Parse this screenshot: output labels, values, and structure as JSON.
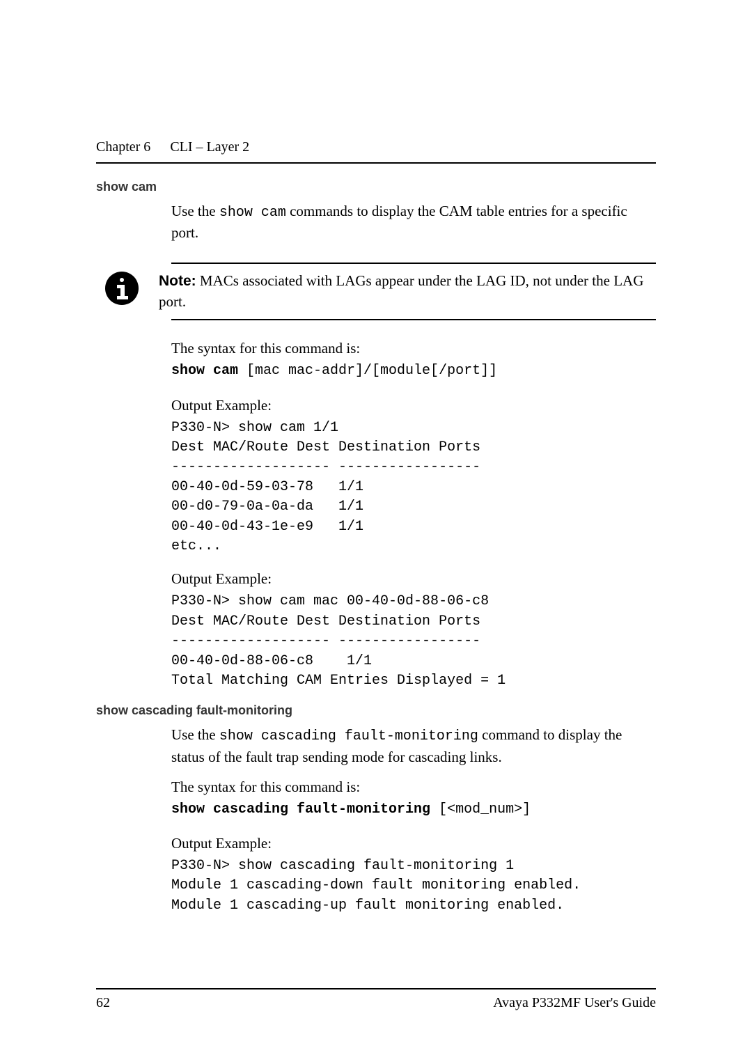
{
  "header": {
    "chapter": "Chapter 6",
    "title": "CLI – Layer 2"
  },
  "section1": {
    "heading": "show cam",
    "intro_pre": "Use the ",
    "intro_cmd": "show cam",
    "intro_post": " commands to display the CAM table entries for a specific port.",
    "note": {
      "label": "Note:",
      "text": "  MACs associated with LAGs appear under the LAG ID, not under the LAG port."
    },
    "syntax_label": "The syntax for this command is:",
    "syntax_cmd": "show cam",
    "syntax_args": " [mac mac-addr]/[module[/port]]",
    "example1_label": "Output Example:",
    "example1_code": "P330-N> show cam 1/1\nDest MAC/Route Dest Destination Ports\n------------------- -----------------\n00-40-0d-59-03-78   1/1\n00-d0-79-0a-0a-da   1/1\n00-40-0d-43-1e-e9   1/1\netc...",
    "example2_label": "Output Example:",
    "example2_code": "P330-N> show cam mac 00-40-0d-88-06-c8\nDest MAC/Route Dest Destination Ports\n------------------- -----------------\n00-40-0d-88-06-c8    1/1\nTotal Matching CAM Entries Displayed = 1"
  },
  "section2": {
    "heading": "show cascading fault-monitoring",
    "intro_pre": "Use the ",
    "intro_cmd": "show cascading fault-monitoring",
    "intro_post": " command to display the status of the fault trap sending mode for cascading links.",
    "syntax_label": "The syntax for this command is:",
    "syntax_cmd": "show cascading fault-monitoring",
    "syntax_args": " [<mod_num>]",
    "example1_label": "Output Example:",
    "example1_code": "P330-N> show cascading fault-monitoring 1\nModule 1 cascading-down fault monitoring enabled.\nModule 1 cascading-up fault monitoring enabled."
  },
  "footer": {
    "page": "62",
    "doc": "Avaya P332MF User's Guide"
  }
}
